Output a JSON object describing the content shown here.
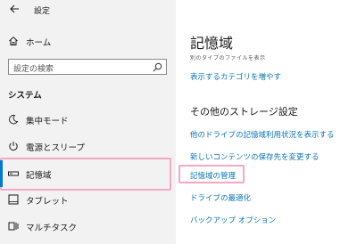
{
  "window": {
    "title": "設定"
  },
  "sidebar": {
    "home_label": "ホーム",
    "search_placeholder": "設定の検索",
    "section_title": "システム",
    "items": [
      {
        "label": "集中モード",
        "icon": "moon-icon"
      },
      {
        "label": "電源とスリープ",
        "icon": "power-icon"
      },
      {
        "label": "記憶域",
        "icon": "storage-icon",
        "selected": true
      },
      {
        "label": "タブレット",
        "icon": "tablet-icon"
      },
      {
        "label": "マルチタスク",
        "icon": "multitask-icon"
      }
    ]
  },
  "main": {
    "title": "記憶域",
    "usage_note": "別のタイプのファイルを表示",
    "show_more_categories_link": "表示するカテゴリを増やす",
    "other_settings_heading": "その他のストレージ設定",
    "links": [
      "他のドライブの記憶域利用状況を表示する",
      "新しいコンテンツの保存先を変更する",
      "記憶域の管理",
      "ドライブの最適化",
      "バックアップ オプション"
    ]
  },
  "colors": {
    "accent": "#0078d4",
    "link": "#0a75b8",
    "highlight": "#f5a8c6",
    "sidebar_bg": "#f2f2f2"
  }
}
